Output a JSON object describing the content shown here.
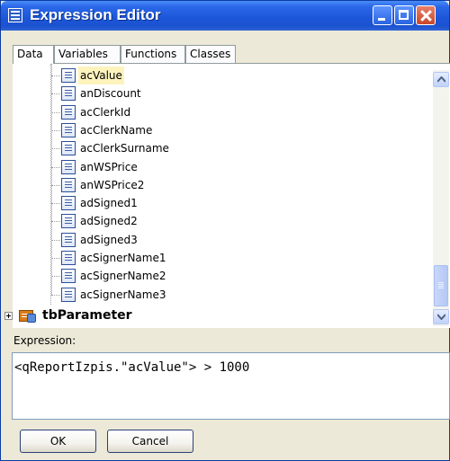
{
  "window": {
    "title": "Expression Editor",
    "titlebar_color": "#2a67e8"
  },
  "tabs": [
    {
      "label": "Data",
      "active": true
    },
    {
      "label": "Variables",
      "active": false
    },
    {
      "label": "Functions",
      "active": false
    },
    {
      "label": "Classes",
      "active": false
    }
  ],
  "tree": {
    "fields": [
      {
        "label": "acValue",
        "selected": true
      },
      {
        "label": "anDiscount"
      },
      {
        "label": "acClerkId"
      },
      {
        "label": "acClerkName"
      },
      {
        "label": "acClerkSurname"
      },
      {
        "label": "anWSPrice"
      },
      {
        "label": "anWSPrice2"
      },
      {
        "label": "adSigned1"
      },
      {
        "label": "adSigned2"
      },
      {
        "label": "adSigned3"
      },
      {
        "label": "acSignerName1"
      },
      {
        "label": "acSignerName2"
      },
      {
        "label": "acSignerName3"
      }
    ],
    "parameter_node": {
      "label": "tbParameter",
      "expanded": false
    }
  },
  "expression": {
    "label": "Expression:",
    "value": "<qReportIzpis.\"acValue\"> > 1000"
  },
  "buttons": {
    "ok": "OK",
    "cancel": "Cancel"
  },
  "icons": {
    "field": "field-icon",
    "table": "table-icon",
    "app": "app-icon"
  }
}
